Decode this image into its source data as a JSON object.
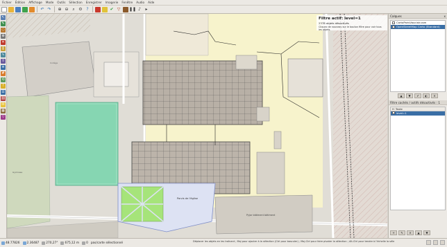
{
  "menu": {
    "items": [
      "Fichier",
      "Édition",
      "Affichage",
      "Mode",
      "Outils",
      "Sélection",
      "Enregistrer",
      "Imagerie",
      "Fenêtre",
      "Audio",
      "Aide"
    ]
  },
  "filter_notice": {
    "title": "Filtre actif: level=1",
    "count_line": "2378 objets désactivés",
    "hint": "Cliquez de nouveau sur le bouton filtre pour voir tous les objets."
  },
  "layers_panel": {
    "title": "Calques",
    "close_label": "x",
    "layers": [
      {
        "name": "CartoParisVauclair.osm",
        "selected": false
      },
      {
        "name": "OpenStreetMap Carto (Standard)",
        "selected": true
      }
    ]
  },
  "filter_panel": {
    "title": "Filtre cachés / actifs désactivés : 1",
    "columns": [
      "H",
      "Texte"
    ],
    "rows": [
      {
        "col1": "",
        "col2": "level=1",
        "selected": true
      }
    ]
  },
  "map_labels": {
    "plaza": "Parvis de l'église",
    "building_b": "Pyjar bâtiment bâtiment"
  },
  "status": {
    "lat": "48.77826",
    "lon": "2.36487",
    "heading": "270,27°",
    "distance": "675,12 m",
    "angle": "0",
    "selection": "pas/carte sélectionné",
    "help": "Déplacer les objets en les traînant ; Maj pour ajouter à la sélection (Ctrl pour basculer) ; Maj-Ctrl pour faire pivoter la sélection ; Alt-Ctrl pour tendre à l'échelle la sélection ; ou modifier la sélection"
  },
  "colors": {
    "accent": "#3a6ea5",
    "map_bg": "#e2dfd8",
    "stadium": "#88d8b4",
    "building": "#d4cfc6",
    "highlight": "#fffccd"
  }
}
